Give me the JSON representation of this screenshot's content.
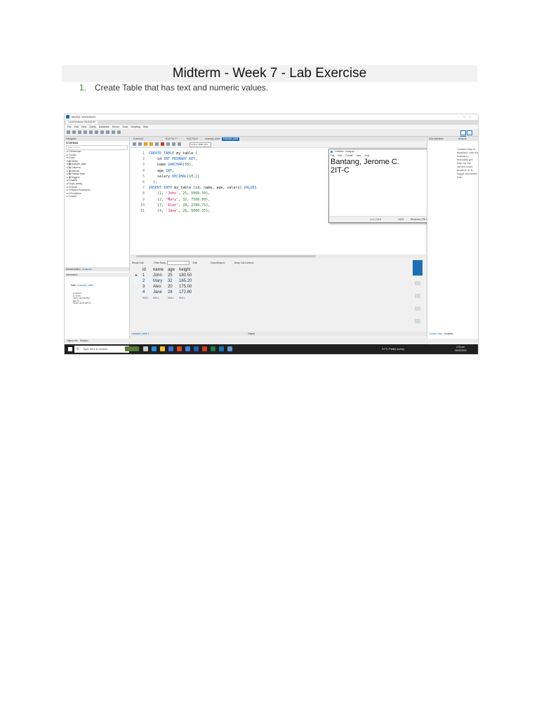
{
  "document": {
    "title": "Midterm - Week 7 - Lab Exercise",
    "item_number": "1.",
    "item_text": "Create Table that has text and numeric values."
  },
  "workbench": {
    "window_title": "MySQL Workbench",
    "connection_tab": "Local instance MySQL80",
    "menu": [
      "File",
      "Edit",
      "View",
      "Query",
      "Database",
      "Server",
      "Tools",
      "Scripting",
      "Help"
    ],
    "navigator": {
      "header": "Navigator",
      "schemas_label": "SCHEMAS",
      "filter_placeholder": "Filter objects",
      "tree": [
        "▸ ⛁ bluecloud",
        "▸ ⛁ coph",
        "▾ ⛁ ope",
        "  ▾ ▤ Tables",
        "    ▾ ▦ example_table",
        "      ▸ ▤ Columns",
        "      ▸ ▤ Indexes",
        "      ▸ ▤ Foreign Keys",
        "      ▸ ▤ Triggers",
        "  ▸ ⛁ sakila",
        "  ▸ ⛁ sys_config",
        "  ▸ ⛁ Views",
        "  ▸ ⛁ Stored Procedures",
        "  ▸ ⛁ Functions",
        "▸ ⛁ world"
      ],
      "tab_admin": "Administration",
      "tab_schemas": "Schemas",
      "info_header": "Information",
      "info_table_prefix": "Table:",
      "info_table_name": "example_table",
      "info_columns_label": "Columns:",
      "info_columns": [
        "id      int PK",
        "name    varchar(50)",
        "age     int",
        "height  decimal(5,2)"
      ]
    },
    "editor_tabs": [
      "Exercise1",
      "SQL File 7*",
      "SQL File 8",
      "example_table",
      "example_table"
    ],
    "limit_label": "Limit to 1000 rows",
    "code_lines": [
      {
        "n": "1",
        "segments": [
          {
            "t": "CREATE TABLE",
            "c": "kw"
          },
          {
            "t": " my_table (",
            "c": "plain"
          }
        ]
      },
      {
        "n": "2",
        "segments": [
          {
            "t": "    id ",
            "c": "plain"
          },
          {
            "t": "INT PRIMARY KEY",
            "c": "kw"
          },
          {
            "t": ",",
            "c": "plain"
          }
        ]
      },
      {
        "n": "3",
        "segments": [
          {
            "t": "    name ",
            "c": "plain"
          },
          {
            "t": "VARCHAR",
            "c": "kw"
          },
          {
            "t": "(",
            "c": "plain"
          },
          {
            "t": "50",
            "c": "num"
          },
          {
            "t": "),",
            "c": "plain"
          }
        ]
      },
      {
        "n": "4",
        "segments": [
          {
            "t": "    age ",
            "c": "plain"
          },
          {
            "t": "INT",
            "c": "kw"
          },
          {
            "t": ",",
            "c": "plain"
          }
        ]
      },
      {
        "n": "5",
        "segments": [
          {
            "t": "    salary ",
            "c": "plain"
          },
          {
            "t": "DECIMAL",
            "c": "kw"
          },
          {
            "t": "(",
            "c": "plain"
          },
          {
            "t": "10",
            "c": "num"
          },
          {
            "t": ",",
            "c": "plain"
          },
          {
            "t": "2",
            "c": "num"
          },
          {
            "t": ")",
            "c": "plain"
          }
        ]
      },
      {
        "n": "6",
        "segments": [
          {
            "t": "  );",
            "c": "plain"
          }
        ]
      },
      {
        "n": "7",
        "segments": [
          {
            "t": "INSERT INTO",
            "c": "kw"
          },
          {
            "t": " my_table (id, name, age, salary) ",
            "c": "plain"
          },
          {
            "t": "VALUES",
            "c": "kw"
          }
        ]
      },
      {
        "n": "8",
        "segments": [
          {
            "t": "    (",
            "c": "plain"
          },
          {
            "t": "1",
            "c": "num"
          },
          {
            "t": ", ",
            "c": "plain"
          },
          {
            "t": "'John'",
            "c": "str"
          },
          {
            "t": ", ",
            "c": "plain"
          },
          {
            "t": "25",
            "c": "num"
          },
          {
            "t": ", ",
            "c": "plain"
          },
          {
            "t": "5000.50",
            "c": "num"
          },
          {
            "t": "),",
            "c": "plain"
          }
        ]
      },
      {
        "n": "9",
        "segments": [
          {
            "t": "    (",
            "c": "plain"
          },
          {
            "t": "2",
            "c": "num"
          },
          {
            "t": ", ",
            "c": "plain"
          },
          {
            "t": "'Mary'",
            "c": "str"
          },
          {
            "t": ", ",
            "c": "plain"
          },
          {
            "t": "32",
            "c": "num"
          },
          {
            "t": ", ",
            "c": "plain"
          },
          {
            "t": "7500.00",
            "c": "num"
          },
          {
            "t": "),",
            "c": "plain"
          }
        ]
      },
      {
        "n": "10",
        "segments": [
          {
            "t": "    (",
            "c": "plain"
          },
          {
            "t": "3",
            "c": "num"
          },
          {
            "t": ", ",
            "c": "plain"
          },
          {
            "t": "'Alex'",
            "c": "str"
          },
          {
            "t": ", ",
            "c": "plain"
          },
          {
            "t": "28",
            "c": "num"
          },
          {
            "t": ", ",
            "c": "plain"
          },
          {
            "t": "2500.75",
            "c": "num"
          },
          {
            "t": "),",
            "c": "plain"
          }
        ]
      },
      {
        "n": "11",
        "segments": [
          {
            "t": "    (",
            "c": "plain"
          },
          {
            "t": "4",
            "c": "num"
          },
          {
            "t": ", ",
            "c": "plain"
          },
          {
            "t": "'Jane'",
            "c": "str"
          },
          {
            "t": ", ",
            "c": "plain"
          },
          {
            "t": "28",
            "c": "num"
          },
          {
            "t": ", ",
            "c": "plain"
          },
          {
            "t": "6000.25",
            "c": "num"
          },
          {
            "t": ");",
            "c": "plain"
          }
        ]
      }
    ],
    "notepad": {
      "title": "*Untitled - Notepad",
      "menu": [
        "File",
        "Edit",
        "Format",
        "View",
        "Help"
      ],
      "line1": "Bantang, Jerome C.",
      "line2": "2IT-C",
      "status_pos": "Ln 1, Col 6",
      "status_zoom": "100%",
      "status_eol": "Windows (CRLF)",
      "status_enc": "UTF-8"
    },
    "result": {
      "label": "Result Grid",
      "filter_label": "Filter Rows:",
      "edit_label": "Edit:",
      "export_label": "Export/Import:",
      "wrap_label": "Wrap Cell Content:",
      "columns": [
        "id",
        "name",
        "age",
        "height"
      ],
      "rows": [
        [
          "1",
          "John",
          "25",
          "180.50"
        ],
        [
          "2",
          "Mary",
          "32",
          "165.20"
        ],
        [
          "3",
          "Alex",
          "20",
          "175.00"
        ],
        [
          "4",
          "Jane",
          "28",
          "172.80"
        ],
        [
          "NULL",
          "NULL",
          "NULL",
          "NULL"
        ]
      ]
    },
    "side_panel": [
      "Result Grid",
      "Form Editor",
      "Field Types",
      "Query Stats",
      "Execution Plan"
    ],
    "right_panel": {
      "header": "SQL Additions",
      "jump_label": "Jump to",
      "help_text": "Context help is disabled. Use the toolbar to manually get help for the current caret position or to toggle automatic help.",
      "tab_context": "Context Help",
      "tab_snippets": "Snippets"
    },
    "output_tab": "example_table 1",
    "output_label": "Output",
    "bottom_tabs": [
      "Object Info",
      "Session"
    ],
    "taskbar": {
      "search_placeholder": "Type here to search",
      "weather": "31°C  Partly sunny",
      "time": "2:00 pm",
      "date": "05/02/2023"
    }
  }
}
